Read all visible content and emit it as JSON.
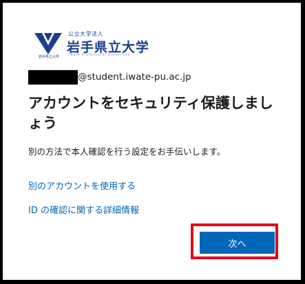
{
  "logo": {
    "org_small": "公立大学法人",
    "org_name": "岩手県立大学",
    "org_english": "Iwate Prefectural University",
    "mark_caption": "岩手県立大学"
  },
  "account": {
    "email_domain": "@student.iwate-pu.ac.jp"
  },
  "title": "アカウントをセキュリティ保護しましょう",
  "description": "別の方法で本人確認を行う設定をお手伝いします。",
  "links": {
    "use_another_account": "別のアカウントを使用する",
    "id_verification_details": "ID の確認に関する詳細情報"
  },
  "buttons": {
    "next": "次へ"
  },
  "colors": {
    "accent": "#0067b8",
    "brand": "#1b3f8f",
    "highlight": "#e2001a"
  }
}
